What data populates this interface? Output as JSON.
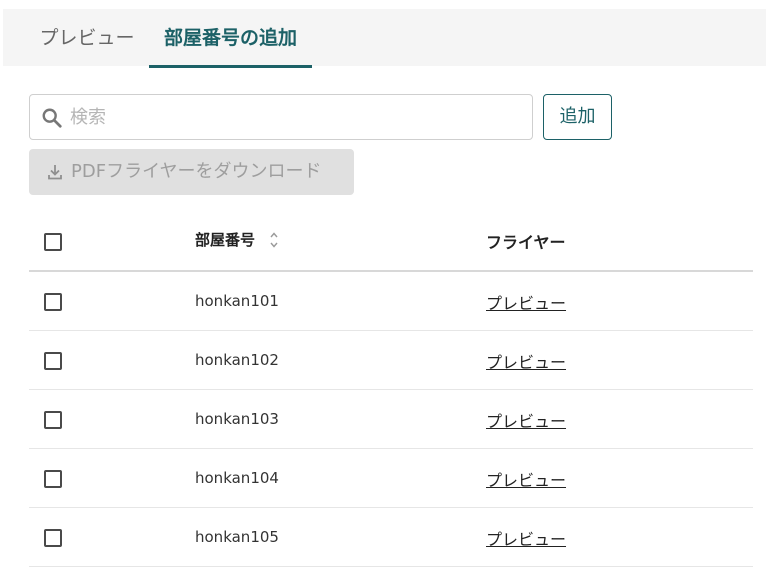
{
  "tabs": [
    {
      "label": "プレビュー",
      "active": false
    },
    {
      "label": "部屋番号の追加",
      "active": true
    }
  ],
  "search": {
    "placeholder": "検索",
    "value": "",
    "icon": "search-icon"
  },
  "add_button": {
    "label": "追加"
  },
  "pdf_button": {
    "label": "PDFフライヤーをダウンロード",
    "icon": "download-icon",
    "disabled": true
  },
  "table": {
    "columns": {
      "room": "部屋番号",
      "flyer": "フライヤー"
    },
    "rows": [
      {
        "room": "honkan101",
        "flyer": "プレビュー",
        "checked": false
      },
      {
        "room": "honkan102",
        "flyer": "プレビュー",
        "checked": false
      },
      {
        "room": "honkan103",
        "flyer": "プレビュー",
        "checked": false
      },
      {
        "room": "honkan104",
        "flyer": "プレビュー",
        "checked": false
      },
      {
        "room": "honkan105",
        "flyer": "プレビュー",
        "checked": false
      }
    ]
  },
  "colors": {
    "accent": "#1c6167",
    "disabled_bg": "#e0e0e0"
  }
}
